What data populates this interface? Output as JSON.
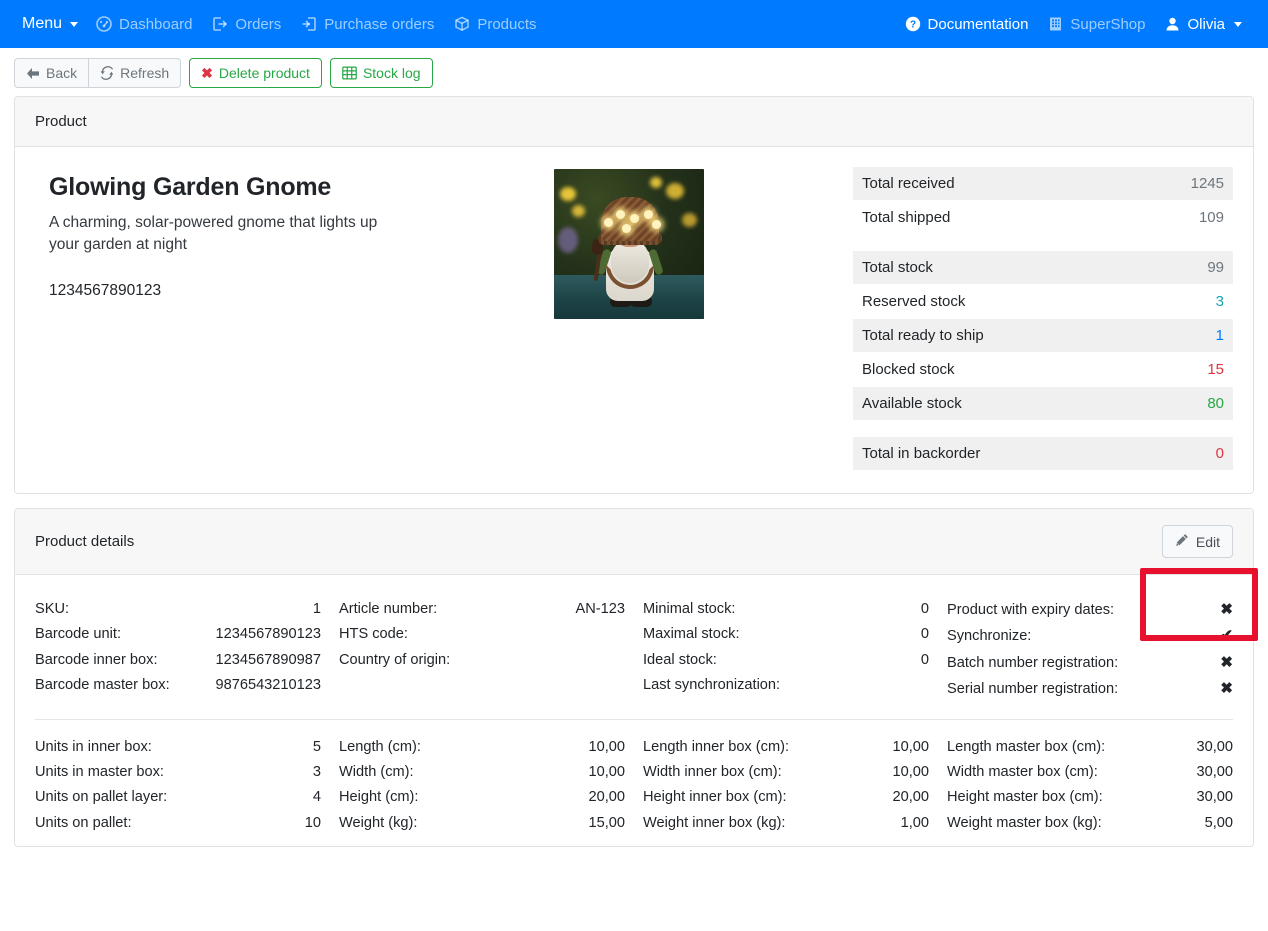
{
  "navbar": {
    "brand": "Menu",
    "left_items": [
      {
        "label": "Dashboard",
        "icon": "dashboard-icon"
      },
      {
        "label": "Orders",
        "icon": "orders-icon"
      },
      {
        "label": "Purchase orders",
        "icon": "purchase-orders-icon"
      },
      {
        "label": "Products",
        "icon": "products-icon"
      }
    ],
    "right_items": [
      {
        "label": "Documentation",
        "icon": "question-circle-icon"
      },
      {
        "label": "SuperShop",
        "icon": "building-icon"
      },
      {
        "label": "Olivia",
        "icon": "user-icon"
      }
    ]
  },
  "toolbar": {
    "back_label": "Back",
    "refresh_label": "Refresh",
    "delete_label": "Delete product",
    "stock_log_label": "Stock log"
  },
  "product_card": {
    "header": "Product",
    "title": "Glowing Garden Gnome",
    "description": "A charming, solar-powered gnome that lights up your garden at night",
    "barcode": "1234567890123",
    "image_alt": "garden-gnome-photo"
  },
  "stock": {
    "groups": [
      [
        {
          "label": "Total received",
          "value": "1245",
          "color": "default",
          "striped": true
        },
        {
          "label": "Total shipped",
          "value": "109",
          "color": "default",
          "striped": false
        }
      ],
      [
        {
          "label": "Total stock",
          "value": "99",
          "color": "default",
          "striped": true
        },
        {
          "label": "Reserved stock",
          "value": "3",
          "color": "info",
          "striped": false
        },
        {
          "label": "Total ready to ship",
          "value": "1",
          "color": "primary",
          "striped": true
        },
        {
          "label": "Blocked stock",
          "value": "15",
          "color": "danger",
          "striped": false
        },
        {
          "label": "Available stock",
          "value": "80",
          "color": "success",
          "striped": true
        }
      ],
      [
        {
          "label": "Total in backorder",
          "value": "0",
          "color": "danger",
          "striped": true
        }
      ]
    ]
  },
  "details_card": {
    "header": "Product details",
    "edit_label": "Edit",
    "top_columns": [
      [
        {
          "key": "SKU:",
          "value": "1"
        },
        {
          "key": "Barcode unit:",
          "value": "1234567890123"
        },
        {
          "key": "Barcode inner box:",
          "value": "1234567890987"
        },
        {
          "key": "Barcode master box:",
          "value": "9876543210123"
        }
      ],
      [
        {
          "key": "Article number:",
          "value": "AN-123"
        },
        {
          "key": "HTS code:",
          "value": ""
        },
        {
          "key": "Country of origin:",
          "value": ""
        }
      ],
      [
        {
          "key": "Minimal stock:",
          "value": "0"
        },
        {
          "key": "Maximal stock:",
          "value": "0"
        },
        {
          "key": "Ideal stock:",
          "value": "0"
        },
        {
          "key": "Last synchronization:",
          "value": ""
        }
      ],
      [
        {
          "key": "Product with expiry dates:",
          "value": "✖",
          "mark": "cross"
        },
        {
          "key": "Synchronize:",
          "value": "✔",
          "mark": "check"
        },
        {
          "key": "Batch number registration:",
          "value": "✖",
          "mark": "cross"
        },
        {
          "key": "Serial number registration:",
          "value": "✖",
          "mark": "cross"
        }
      ]
    ],
    "bottom_columns": [
      [
        {
          "key": "Units in inner box:",
          "value": "5"
        },
        {
          "key": "Units in master box:",
          "value": "3"
        },
        {
          "key": "Units on pallet layer:",
          "value": "4"
        },
        {
          "key": "Units on pallet:",
          "value": "10"
        }
      ],
      [
        {
          "key": "Length (cm):",
          "value": "10,00"
        },
        {
          "key": "Width (cm):",
          "value": "10,00"
        },
        {
          "key": "Height (cm):",
          "value": "20,00"
        },
        {
          "key": "Weight (kg):",
          "value": "15,00"
        }
      ],
      [
        {
          "key": "Length inner box (cm):",
          "value": "10,00"
        },
        {
          "key": "Width inner box (cm):",
          "value": "10,00"
        },
        {
          "key": "Height inner box (cm):",
          "value": "20,00"
        },
        {
          "key": "Weight inner box (kg):",
          "value": "1,00"
        }
      ],
      [
        {
          "key": "Length master box (cm):",
          "value": "30,00"
        },
        {
          "key": "Width master box (cm):",
          "value": "30,00"
        },
        {
          "key": "Height master box (cm):",
          "value": "30,00"
        },
        {
          "key": "Weight master box (kg):",
          "value": "5,00"
        }
      ]
    ]
  },
  "annotation": {
    "target": "edit-button",
    "color": "#e8112d"
  },
  "colors": {
    "navbar_bg": "#007bff",
    "success": "#28a745",
    "danger": "#dc3545",
    "info": "#17a2b8",
    "primary": "#007bff",
    "muted": "#6c757d"
  }
}
